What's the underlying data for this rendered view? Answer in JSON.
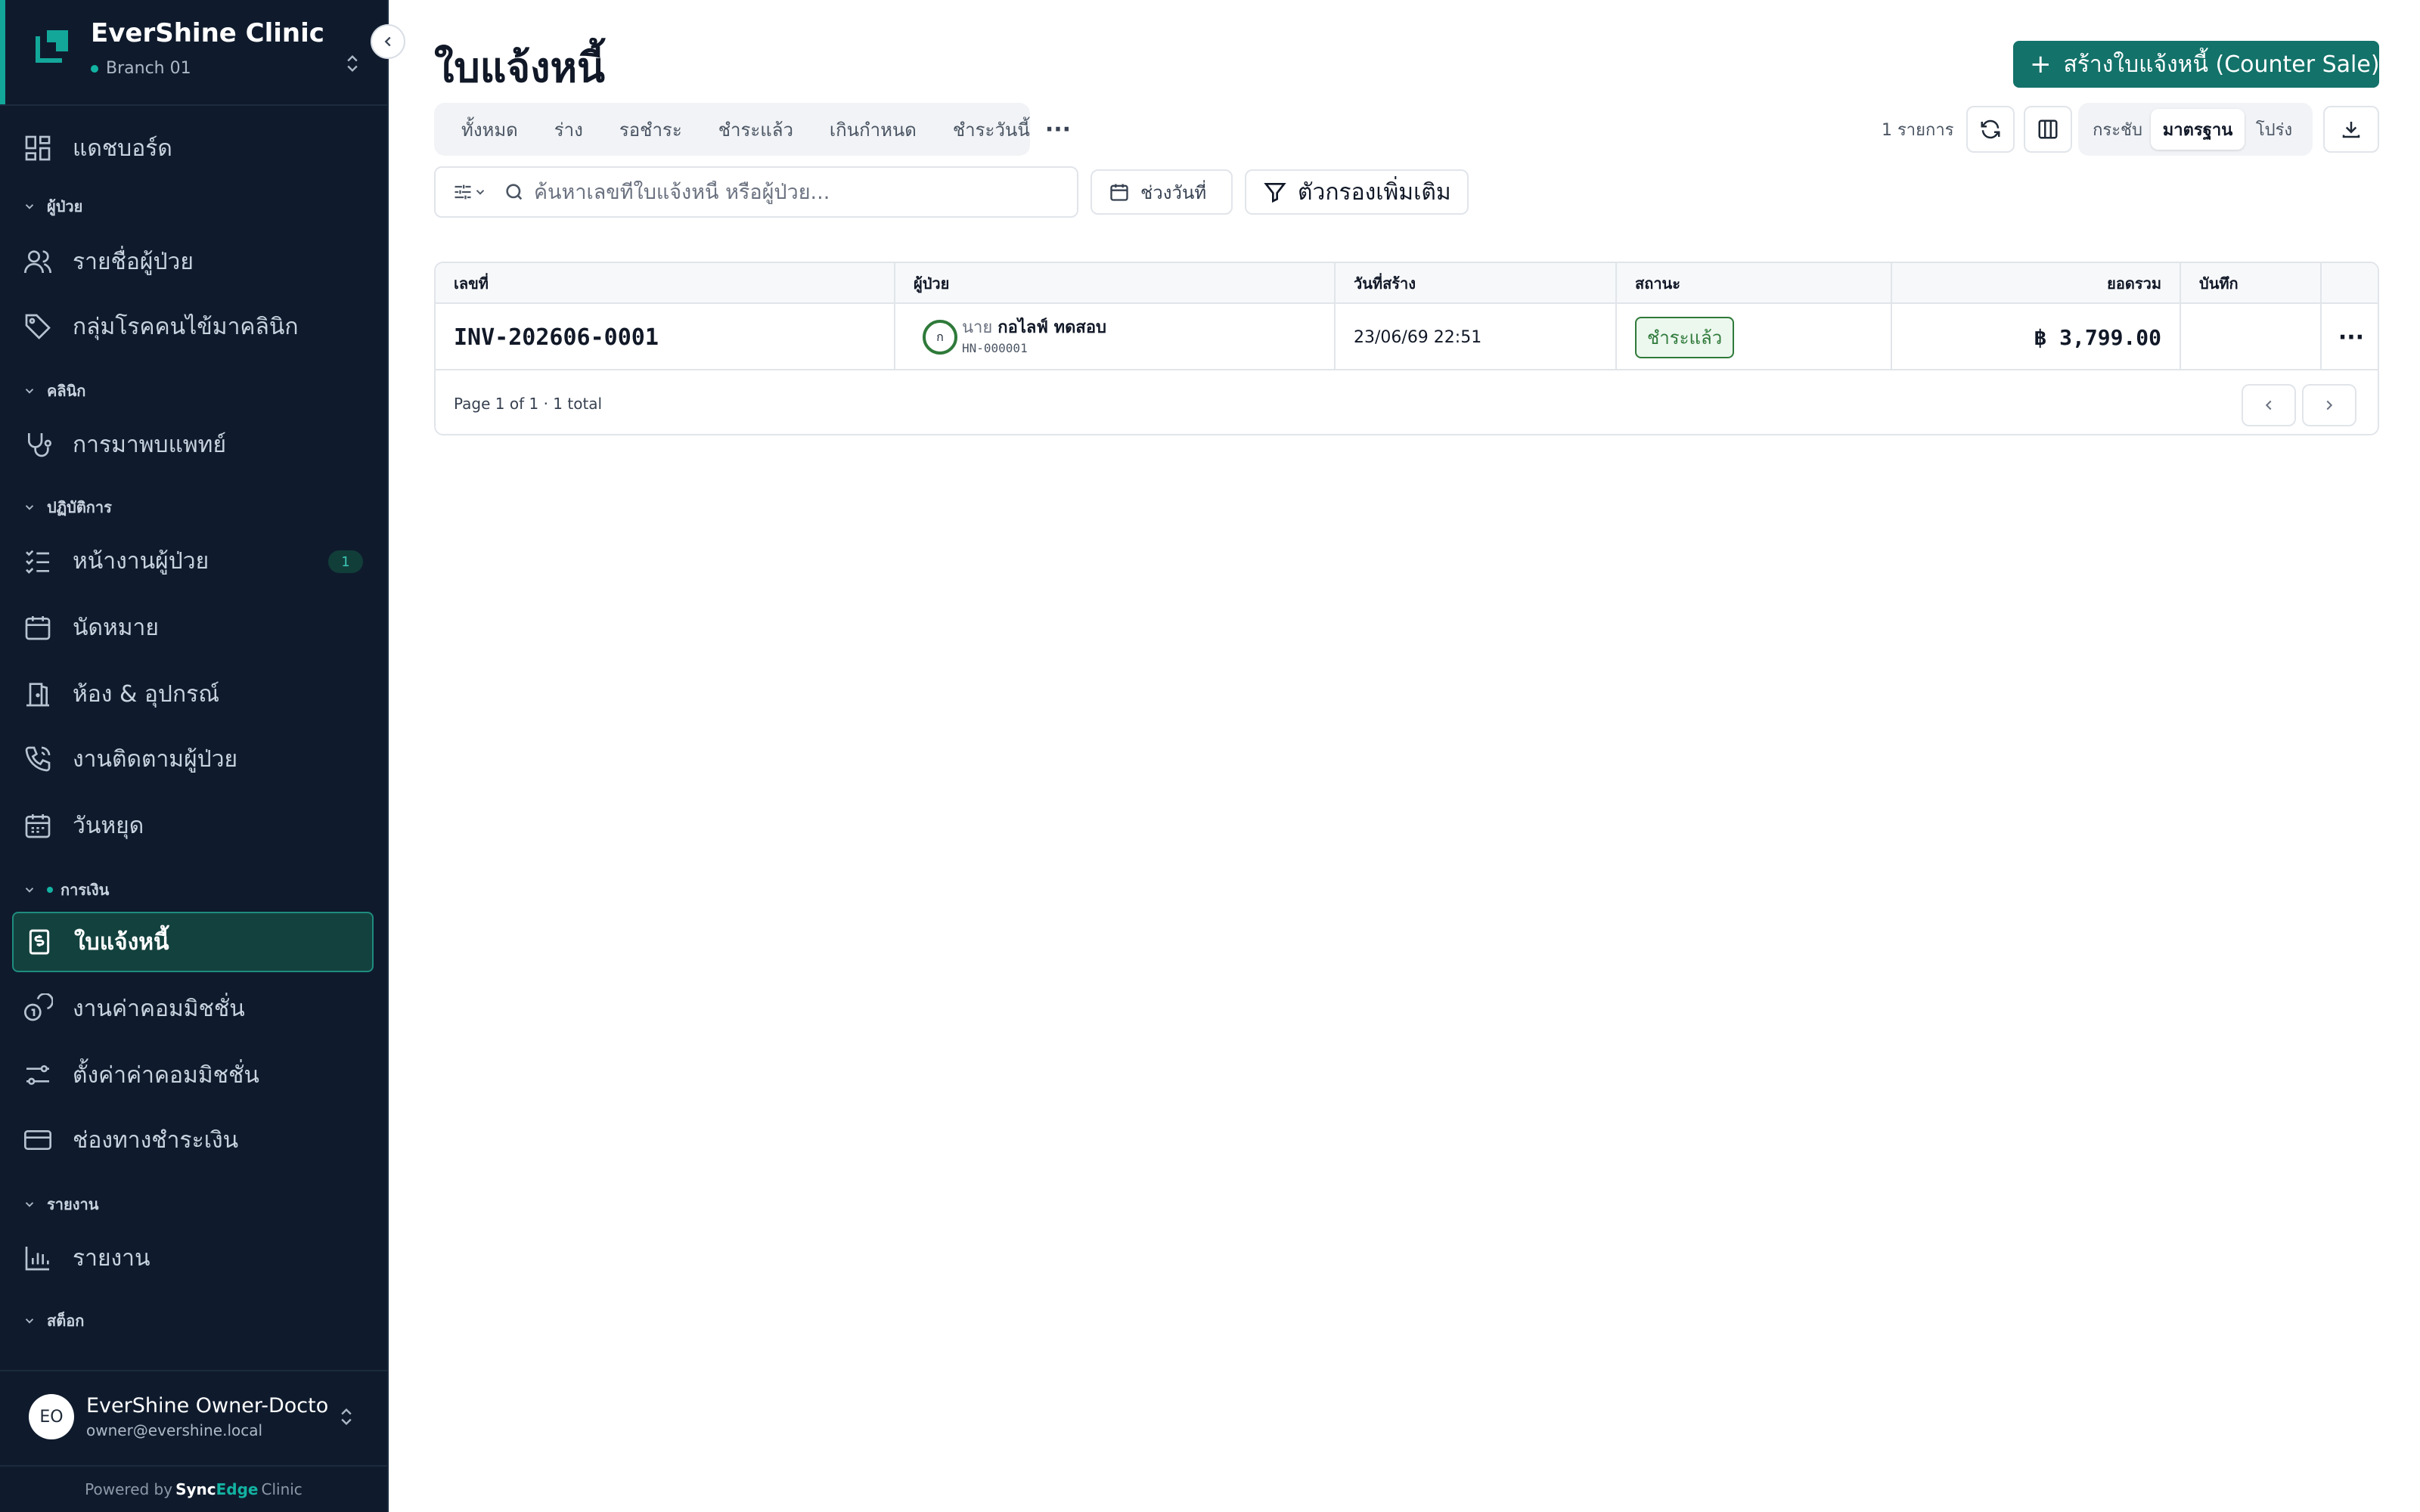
{
  "app": {
    "name": "EverShine Clinic",
    "branch": "Branch 01",
    "brand_color": "#13726a",
    "sidebar_bg": "#0f1b2d"
  },
  "sidebar": {
    "items": [
      {
        "label": "แดชบอร์ด",
        "icon": "dashboard-icon"
      },
      {
        "section": "ผู้ป่วย"
      },
      {
        "label": "รายชื่อผู้ป่วย",
        "icon": "users-icon"
      },
      {
        "label": "กลุ่มโรคคนไข้มาคลินิก",
        "icon": "tag-icon"
      },
      {
        "section": "คลินิก"
      },
      {
        "label": "การมาพบแพทย์",
        "icon": "stethoscope-icon"
      },
      {
        "section": "ปฏิบัติการ"
      },
      {
        "label": "หน้างานผู้ป่วย",
        "icon": "checklist-icon",
        "badge": "1"
      },
      {
        "label": "นัดหมาย",
        "icon": "calendar-icon"
      },
      {
        "label": "ห้อง & อุปกรณ์",
        "icon": "door-icon"
      },
      {
        "label": "งานติดตามผู้ป่วย",
        "icon": "phone-icon"
      },
      {
        "label": "วันหยุด",
        "icon": "calendar-grid-icon"
      },
      {
        "section": "การเงิน"
      },
      {
        "label": "ใบแจ้งหนี้",
        "icon": "invoice-icon",
        "active": true
      },
      {
        "label": "งานค่าคอมมิชชั่น",
        "icon": "coins-icon"
      },
      {
        "label": "ตั้งค่าค่าคอมมิชชั่น",
        "icon": "sliders-icon"
      },
      {
        "label": "ช่องทางชำระเงิน",
        "icon": "credit-card-icon"
      },
      {
        "section": "รายงาน"
      },
      {
        "label": "รายงาน",
        "icon": "bar-chart-icon"
      },
      {
        "section": "สต็อก"
      }
    ]
  },
  "user": {
    "initials": "EO",
    "name": "EverShine Owner-Doctor",
    "email": "owner@evershine.local"
  },
  "footer": {
    "powered_prefix": "Powered by",
    "powered_sync": "Sync",
    "powered_edge": "Edge",
    "powered_suffix": "Clinic"
  },
  "page": {
    "title": "ใบแจ้งหนี้",
    "create_button": "สร้างใบแจ้งหนี้ (Counter Sale)"
  },
  "tabs": [
    "ทั้งหมด",
    "ร่าง",
    "รอชำระ",
    "ชำระแล้ว",
    "เกินกำหนด",
    "ชำระวันนี้"
  ],
  "toolbar": {
    "count": "1 รายการ",
    "density": [
      "กระชับ",
      "มาตรฐาน",
      "โปร่ง"
    ],
    "density_selected": "มาตรฐาน"
  },
  "search": {
    "placeholder": "ค้นหาเลขที่ใบแจ้งหนี้ หรือผู้ป่วย...",
    "value": ""
  },
  "filters": {
    "date_range": "ช่วงวันที่",
    "more": "ตัวกรองเพิ่มเติม"
  },
  "table": {
    "columns": [
      "เลขที่",
      "ผู้ป่วย",
      "วันที่สร้าง",
      "สถานะ",
      "ยอดรวม",
      "บันทึก"
    ],
    "rows": [
      {
        "invoice_no": "INV-202606-0001",
        "patient_initial": "ก",
        "patient_prefix": "นาย",
        "patient_name": "กอไลฟ์ ทดสอบ",
        "patient_hn": "HN-000001",
        "created": "23/06/69 22:51",
        "status": "ชำระแล้ว",
        "total": "฿ 3,799.00",
        "note": ""
      }
    ],
    "pagination": "Page 1 of 1 · 1 total"
  }
}
